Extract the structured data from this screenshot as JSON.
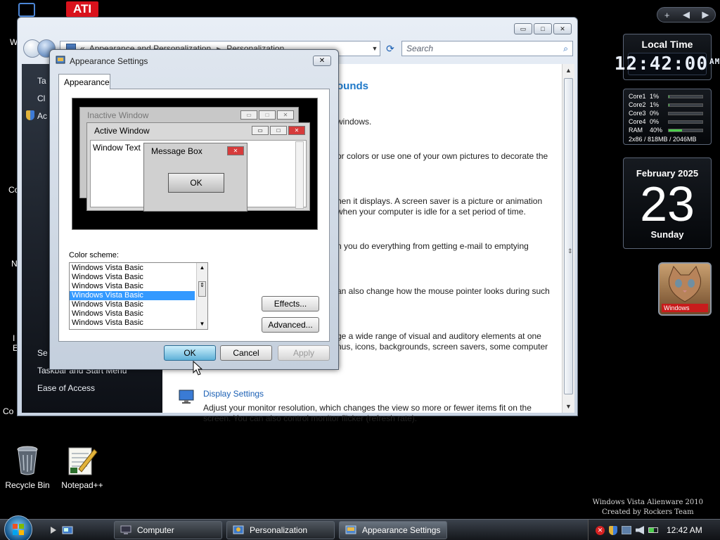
{
  "desktop": {
    "icons": [
      {
        "label": "Recycle Bin",
        "icon": "recycle-bin-icon"
      },
      {
        "label": "Notepad++",
        "icon": "notepad-plus-plus-icon"
      }
    ],
    "edge_fragments": [
      "W",
      "Co",
      "N",
      "I",
      "E",
      "Co"
    ],
    "watermark": {
      "line1": "Windows Vista Alienware 2010",
      "line2": "Created by Rockers Team"
    }
  },
  "sidebar": {
    "toolbar": [
      "+",
      "◀",
      "▶"
    ],
    "clock": {
      "title": "Local Time",
      "time": "12:42:00",
      "ampm": "AM"
    },
    "cpu": {
      "rows": [
        {
          "label": "Core1",
          "pct": "1%",
          "level": 0.01
        },
        {
          "label": "Core2",
          "pct": "1%",
          "level": 0.01
        },
        {
          "label": "Core3",
          "pct": "0%",
          "level": 0
        },
        {
          "label": "Core4",
          "pct": "0%",
          "level": 0
        },
        {
          "label": "RAM",
          "pct": "40%",
          "level": 0.4
        }
      ],
      "footer": "2x86 / 818MB / 2046MB"
    },
    "calendar": {
      "month": "February 2025",
      "day": "23",
      "weekday": "Sunday"
    },
    "slideshow": {
      "caption": "Windows"
    }
  },
  "personalization": {
    "address": {
      "back": "«",
      "crumb1": "Appearance and Personalization",
      "sep": "▸",
      "crumb2": "Personalization"
    },
    "search_placeholder": "Search",
    "left_items": [
      "Ta",
      "Cl",
      "Ac",
      "Se",
      "Taskbar and Start Menu",
      "Ease of Access"
    ],
    "heading_fragment": "ounds",
    "fragments": [
      "windows.",
      "or colors or use one of your own pictures to decorate the",
      "hen it displays. A screen saver is a picture or animation",
      "when your computer is idle for a set period of time.",
      "n you do everything from getting e-mail to emptying",
      "an also change how the mouse pointer looks during such",
      "ge a wide range of visual and auditory elements at one",
      "nus, icons, backgrounds, screen savers, some computer"
    ],
    "display_settings": {
      "link": "Display Settings",
      "desc": "Adjust your monitor resolution, which changes the view so more or fewer items fit on the screen. You can also control monitor flicker (refresh rate)."
    }
  },
  "dialog": {
    "title": "Appearance Settings",
    "tab": "Appearance",
    "preview": {
      "inactive": "Inactive Window",
      "active": "Active Window",
      "window_text": "Window Text",
      "message_box": "Message Box",
      "ok": "OK"
    },
    "color_scheme_label": "Color scheme:",
    "color_schemes": [
      "Windows Vista Basic",
      "Windows Vista Basic",
      "Windows Vista Basic",
      "Windows Vista Basic",
      "Windows Vista Basic",
      "Windows Vista Basic",
      "Windows Vista Basic"
    ],
    "selected_index": 3,
    "effects": "Effects...",
    "advanced": "Advanced...",
    "ok": "OK",
    "cancel": "Cancel",
    "apply": "Apply"
  },
  "taskbar": {
    "buttons": [
      {
        "label": "Computer",
        "icon": "computer-icon"
      },
      {
        "label": "Personalization",
        "icon": "personalization-icon"
      },
      {
        "label": "Appearance Settings",
        "icon": "appearance-settings-icon"
      }
    ],
    "clock": "12:42 AM"
  }
}
